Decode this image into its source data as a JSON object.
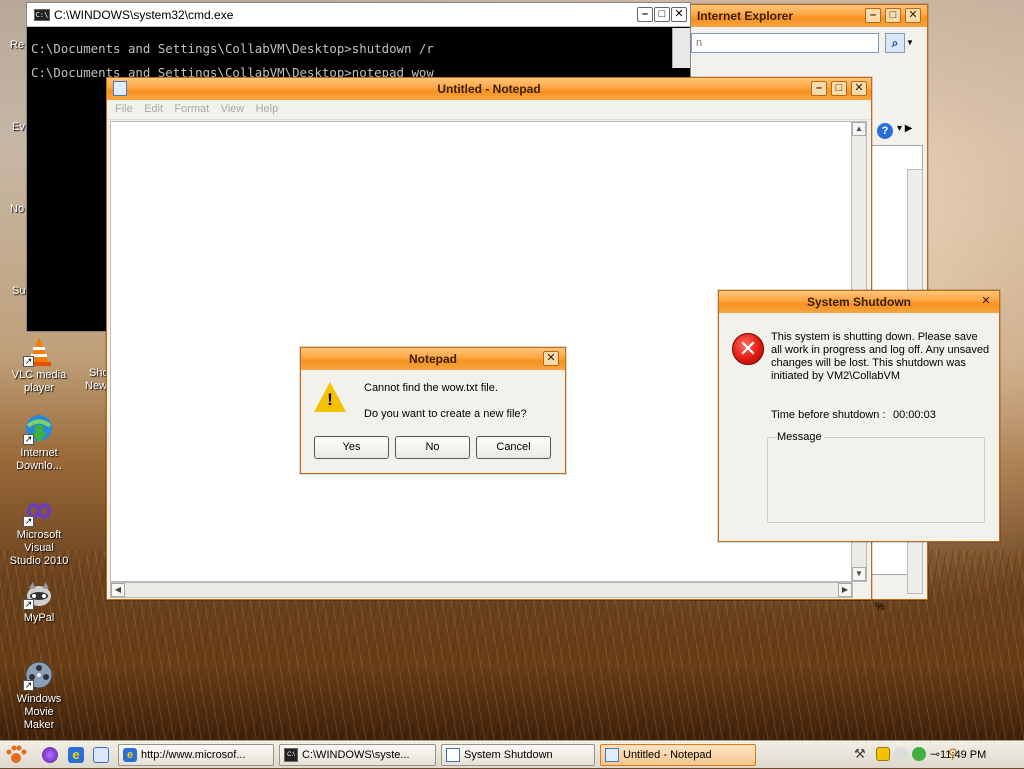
{
  "desktop": {
    "icons": [
      {
        "label_l1": "VLC media",
        "label_l2": "player"
      },
      {
        "label_l1": "Internet",
        "label_l2": "Downlo..."
      },
      {
        "label_l1": "Microsoft Visual",
        "label_l2": "Studio 2010"
      },
      {
        "label_l1": "MyPal",
        "label_l2": ""
      },
      {
        "label_l1": "Windows Movie",
        "label_l2": "Maker"
      }
    ],
    "partial_labels": [
      "Re",
      "Ev",
      "No",
      "Su",
      "Sho",
      "New"
    ]
  },
  "cmd": {
    "title": "C:\\WINDOWS\\system32\\cmd.exe",
    "icon_text": "C:\\",
    "lines": [
      "C:\\Documents and Settings\\CollabVM\\Desktop>shutdown /r",
      "C:\\Documents and Settings\\CollabVM\\Desktop>notepad wow"
    ]
  },
  "ie": {
    "title": "Internet Explorer",
    "address_fragment": "n",
    "zoom_fragment": "%"
  },
  "notepad": {
    "title": "Untitled - Notepad",
    "menu": [
      "File",
      "Edit",
      "Format",
      "View",
      "Help"
    ]
  },
  "notepad_dialog": {
    "title": "Notepad",
    "line1": "Cannot find the wow.txt file.",
    "line2": "Do you want to create a new file?",
    "buttons": {
      "yes": "Yes",
      "no": "No",
      "cancel": "Cancel"
    }
  },
  "shutdown_dialog": {
    "title": "System Shutdown",
    "message": "This system is shutting down. Please save all work in progress and log off. Any unsaved changes will be lost. This shutdown was initiated by VM2\\CollabVM",
    "time_label": "Time before shutdown :",
    "time_value": "00:00:03",
    "message_group_label": "Message"
  },
  "taskbar": {
    "tasks": [
      {
        "label": "http://www.microsof..."
      },
      {
        "label": "C:\\WINDOWS\\syste..."
      },
      {
        "label": "System Shutdown"
      },
      {
        "label": "Untitled - Notepad"
      }
    ],
    "clock": "11:49 PM"
  },
  "colors": {
    "title_orange": "#f7921f",
    "error_red": "#e01a10",
    "warning_yellow": "#f2c200"
  }
}
